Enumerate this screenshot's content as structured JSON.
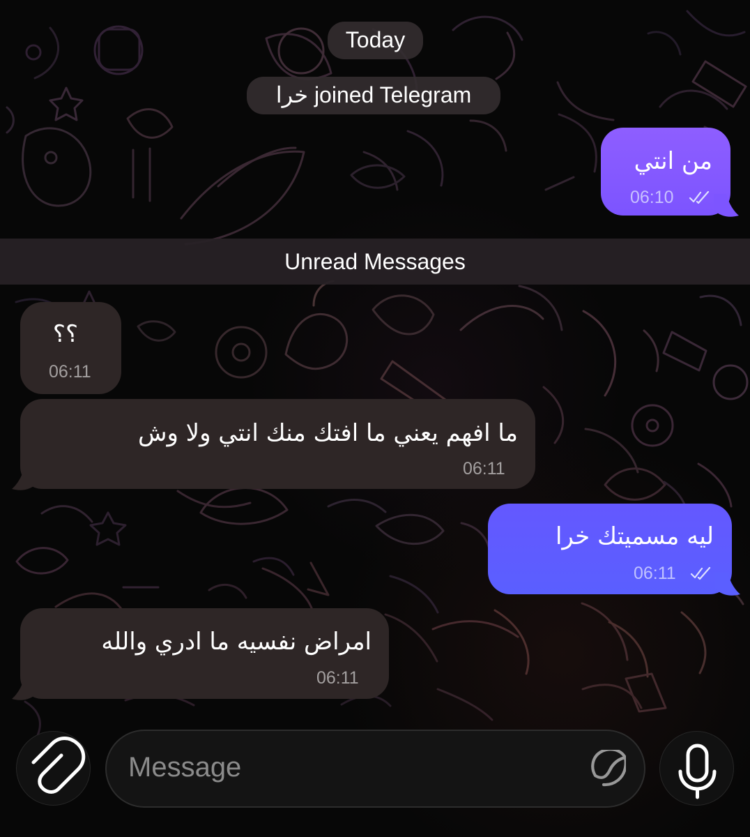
{
  "service": {
    "date": "Today",
    "joined": "خرا joined Telegram",
    "unread_label": "Unread Messages"
  },
  "messages": [
    {
      "direction": "outgoing",
      "text": "من انتي",
      "time": "06:10",
      "status": "read"
    },
    {
      "direction": "incoming",
      "text": "؟؟",
      "time": "06:11"
    },
    {
      "direction": "incoming",
      "text": "ما افهم يعني ما افتك منك انتي ولا وش",
      "time": "06:11"
    },
    {
      "direction": "outgoing",
      "text": "ليه مسميتك خرا",
      "time": "06:11",
      "status": "read"
    },
    {
      "direction": "incoming",
      "text": "امراض نفسيه ما ادري والله",
      "time": "06:11"
    }
  ],
  "composer": {
    "placeholder": "Message",
    "value": ""
  },
  "icons": {
    "attach": "paperclip-icon",
    "sticker": "sticker-icon",
    "voice": "microphone-icon",
    "read_status": "double-check-icon"
  },
  "colors": {
    "background": "#070707",
    "incoming_bubble": "#2e2626",
    "outgoing_violet": "#8e5eff",
    "outgoing_blue": "#6458ff",
    "service_pill": "#342d30"
  }
}
